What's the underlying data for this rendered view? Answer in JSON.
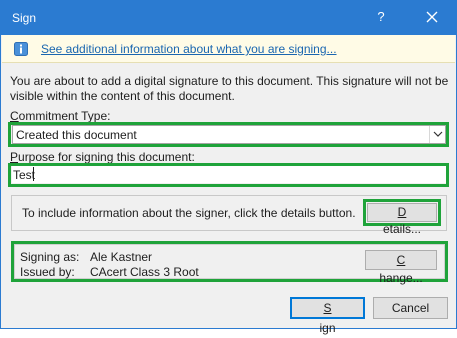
{
  "window": {
    "title": "Sign",
    "help_glyph": "?",
    "close_icon": "close-icon"
  },
  "info_bar": {
    "icon": "info-icon",
    "link_text": "See additional information about what you are signing..."
  },
  "description": "You are about to add a digital signature to this document. This signature will not be visible within the content of this document.",
  "commitment": {
    "label_prefix": "",
    "label_accel": "C",
    "label_rest": "ommitment Type:",
    "selected": "Created this document"
  },
  "purpose": {
    "label_prefix": "",
    "label_accel": "P",
    "label_rest": "urpose for signing this document:",
    "value": "Test"
  },
  "details": {
    "text": "To include information about the signer, click the details button.",
    "button_prefix": "",
    "button_accel": "D",
    "button_rest": "etails..."
  },
  "signer": {
    "signing_as_label": "Signing as:",
    "signing_as_value": "Ale Kastner",
    "issued_by_label": "Issued by:",
    "issued_by_value": "CAcert Class 3 Root",
    "change_prefix": "",
    "change_accel": "C",
    "change_rest": "hange..."
  },
  "buttons": {
    "sign_prefix": "",
    "sign_accel": "S",
    "sign_rest": "ign",
    "cancel": "Cancel"
  },
  "colors": {
    "title_bar": "#2b7bd1",
    "highlight": "#1fa33a",
    "link": "#1a66b0",
    "info_background": "#fffbe6"
  }
}
